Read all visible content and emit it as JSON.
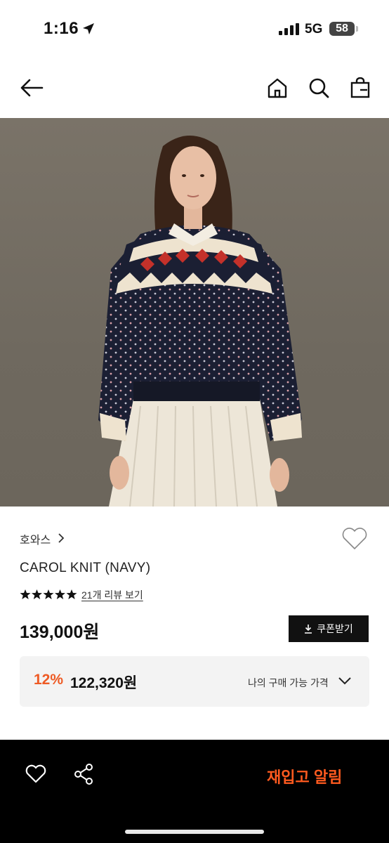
{
  "status_bar": {
    "time": "1:16",
    "network": "5G",
    "battery": "58"
  },
  "nav": {
    "back_icon": "arrow-left-icon",
    "home_icon": "home-icon",
    "search_icon": "search-icon",
    "bag_icon": "shopping-bag-icon"
  },
  "product": {
    "brand": "호와스",
    "name": "CAROL KNIT (NAVY)",
    "rating_stars": 5,
    "review_link": "21개 리뷰 보기",
    "price": "139,000원",
    "coupon_button": "쿠폰받기",
    "discount_percent": "12%",
    "discount_price": "122,320원",
    "my_price_label": "나의 구매 가능 가격"
  },
  "bottom_bar": {
    "restock_label": "재입고 알림",
    "wishlist_icon": "heart-icon",
    "share_icon": "share-icon"
  },
  "colors": {
    "accent": "#ee5a24",
    "restock": "#ff5a1f",
    "bottom_bar_bg": "#000000",
    "deal_box_bg": "#f3f3f3"
  }
}
